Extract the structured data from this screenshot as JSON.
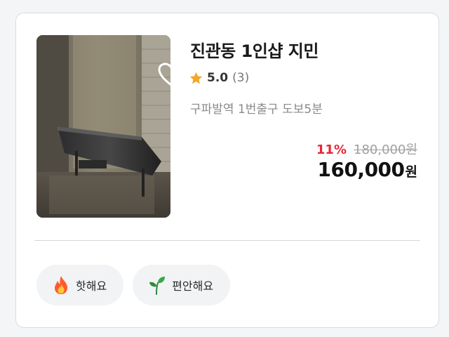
{
  "listing": {
    "title": "진관동 1인샵 지민",
    "rating": "5.0",
    "review_count": "(3)",
    "location": "구파발역 1번출구 도보5분",
    "discount": "11%",
    "original_price": "180,000원",
    "final_price": "160,000",
    "currency": "원",
    "favorited": false
  },
  "tags": [
    {
      "label": "핫해요",
      "icon": "fire-icon"
    },
    {
      "label": "편안해요",
      "icon": "sprout-icon"
    }
  ],
  "colors": {
    "discount": "#e8263a",
    "star": "#f5a623",
    "tag_background": "#f1f3f5"
  }
}
